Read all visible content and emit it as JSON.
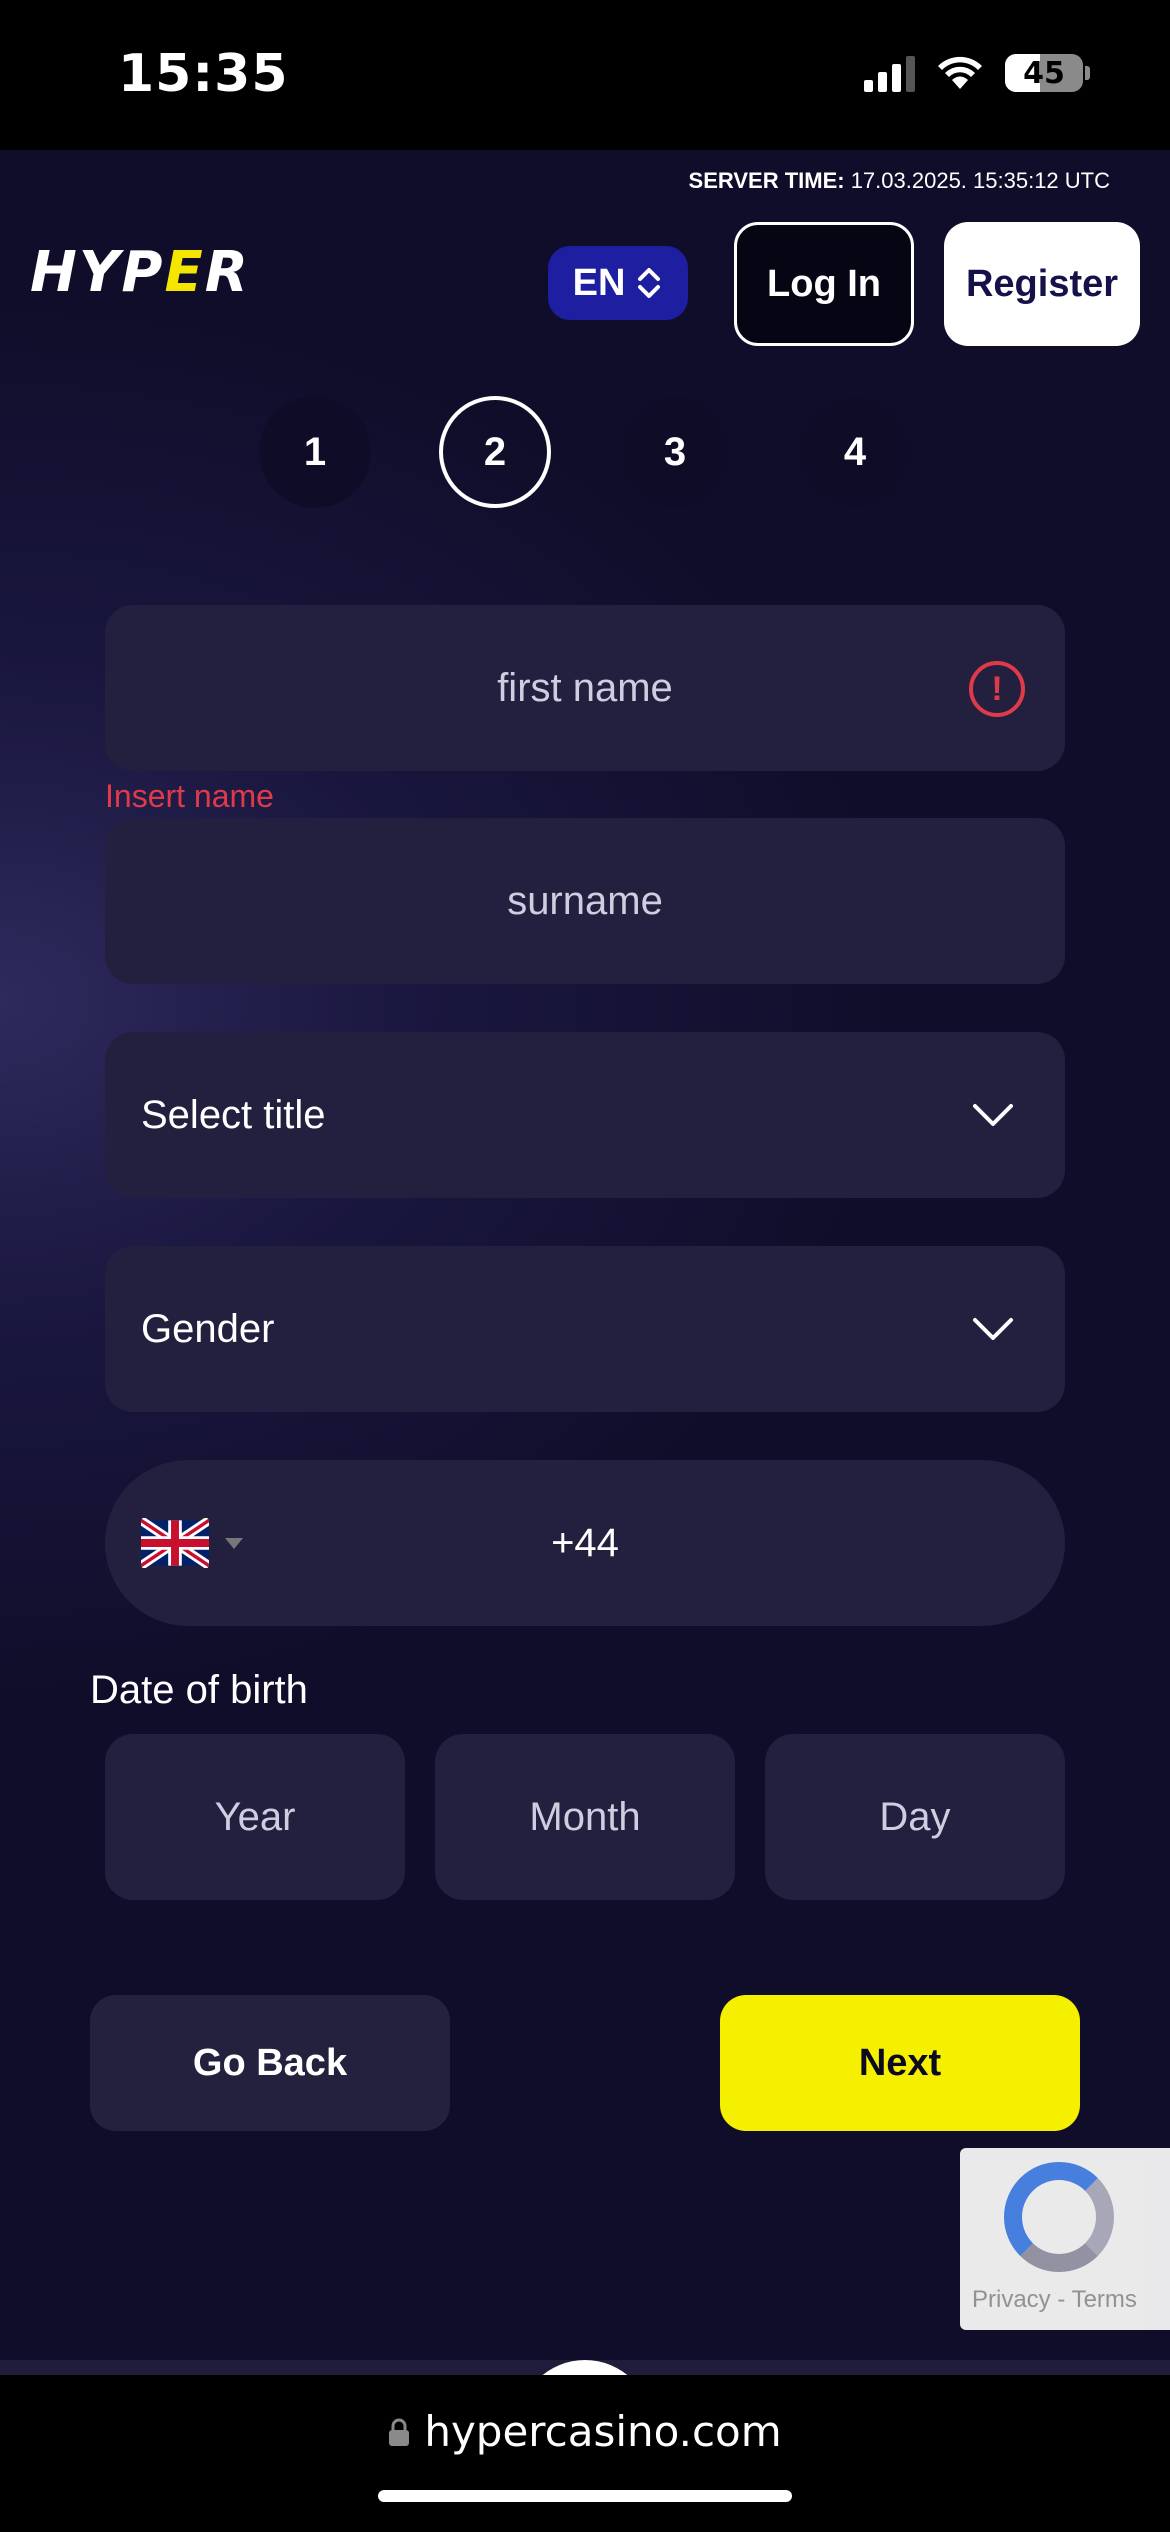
{
  "status_bar": {
    "time": "15:35",
    "battery": "45",
    "battery_level_percent": 45
  },
  "header": {
    "server_time_label": "SERVER TIME:",
    "server_time_value": " 17.03.2025. 15:35:12 UTC",
    "logo_left": "HYP",
    "logo_bolt": "E",
    "logo_right": "R",
    "language": "EN",
    "login_label": "Log In",
    "register_label": "Register"
  },
  "steps": [
    "1",
    "2",
    "3",
    "4"
  ],
  "active_step": 2,
  "form": {
    "first_name_placeholder": "first name",
    "first_name_error_icon": "!",
    "first_name_error": "Insert name",
    "surname_placeholder": "surname",
    "title_select": "Select title",
    "gender_select": "Gender",
    "phone_code": "+44",
    "dob_label": "Date of birth",
    "dob_year": "Year",
    "dob_month": "Month",
    "dob_day": "Day"
  },
  "actions": {
    "back_label": "Go Back",
    "next_label": "Next"
  },
  "recaptcha": {
    "text": "Privacy - Terms"
  },
  "browser": {
    "url": "hypercasino.com"
  },
  "colors": {
    "accent": "#f5ef00",
    "error": "#e03a4a",
    "background": "#100d2a",
    "lang_button": "#1d1fa0"
  }
}
